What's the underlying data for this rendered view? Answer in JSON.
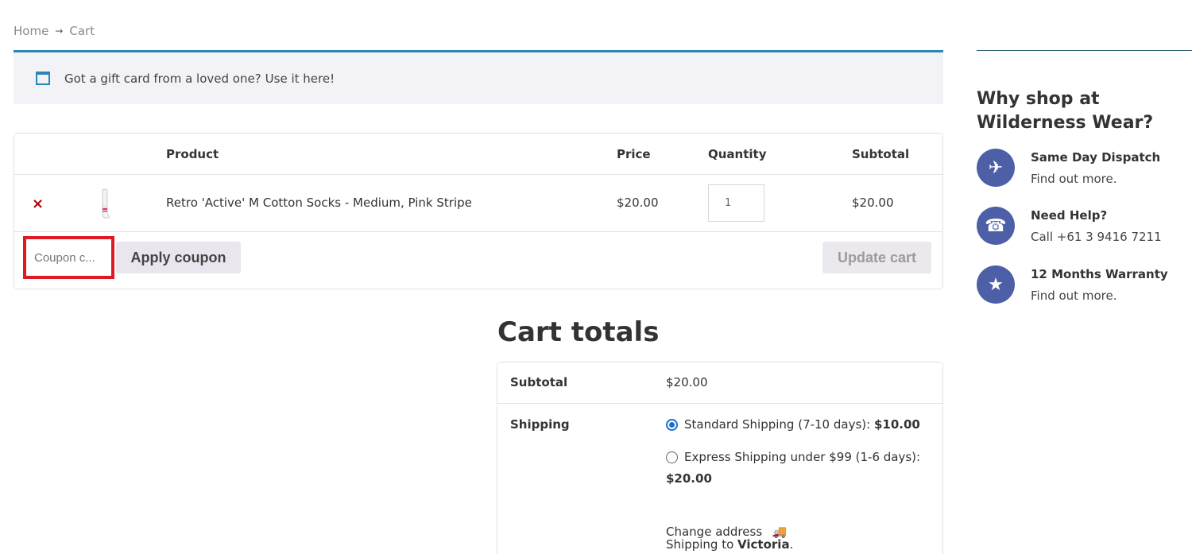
{
  "breadcrumb": {
    "home": "Home",
    "sep": "→",
    "current": "Cart"
  },
  "notice": {
    "text": "Got a gift card from a loved one?",
    "link": "Use it here!"
  },
  "cart": {
    "headers": {
      "product": "Product",
      "price": "Price",
      "quantity": "Quantity",
      "subtotal": "Subtotal"
    },
    "items": [
      {
        "remove": "×",
        "name": "Retro 'Active' M Cotton Socks - Medium, Pink Stripe",
        "price": "$20.00",
        "quantity": "1",
        "subtotal": "$20.00"
      }
    ],
    "coupon_placeholder": "Coupon c...",
    "apply_label": "Apply coupon",
    "update_label": "Update cart"
  },
  "totals": {
    "title": "Cart totals",
    "subtotal_label": "Subtotal",
    "subtotal_value": "$20.00",
    "shipping_label": "Shipping",
    "options": [
      {
        "label": "Standard Shipping (7-10 days):",
        "price": "$10.00",
        "selected": true
      },
      {
        "label": "Express Shipping under $99 (1-6 days):",
        "price": "$20.00",
        "selected": false
      }
    ],
    "shipping_to_prefix": "Shipping to",
    "shipping_to_region": "Victoria",
    "change_address": "Change address"
  },
  "sidebar": {
    "title": "Why shop at Wilderness Wear?",
    "perks": [
      {
        "icon": "plane-icon",
        "title": "Same Day Dispatch",
        "sub": "Find out more."
      },
      {
        "icon": "phone-icon",
        "title": "Need Help?",
        "sub": "Call +61 3 9416 7211"
      },
      {
        "icon": "star-icon",
        "title": "12 Months Warranty",
        "sub": "Find out more."
      }
    ]
  },
  "colors": {
    "accent": "#2a86b5",
    "perk_circle": "#4d5fa7",
    "remove": "#b30000",
    "highlight": "#e01a22"
  }
}
